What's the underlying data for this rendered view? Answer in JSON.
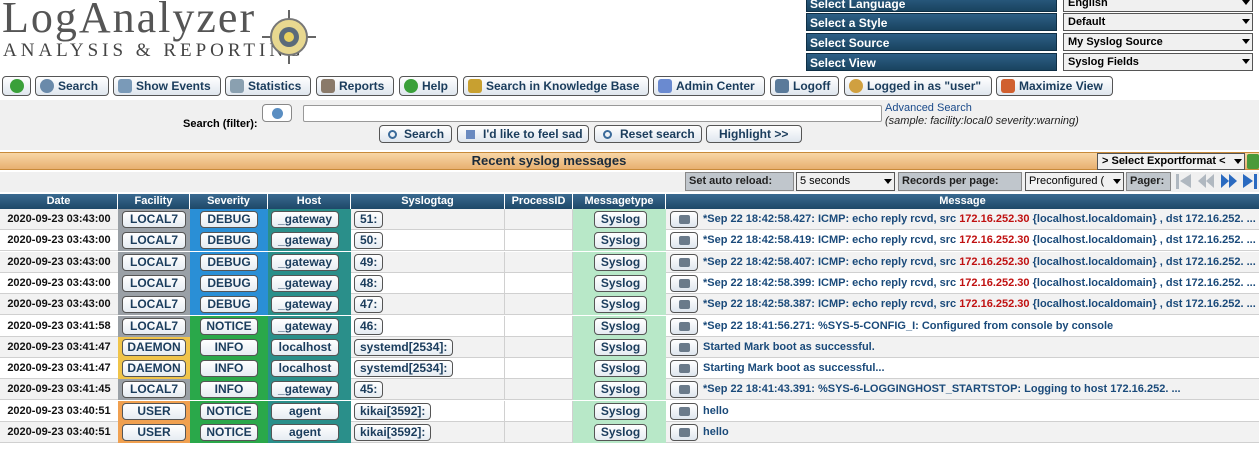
{
  "logo": {
    "title": "LogAnalyzer",
    "subtitle": "ANALYSIS & REPORTING"
  },
  "settings": [
    {
      "label": "Select Language",
      "value": "English"
    },
    {
      "label": "Select a Style",
      "value": "Default"
    },
    {
      "label": "Select Source",
      "value": "My Syslog Source"
    },
    {
      "label": "Select View",
      "value": "Syslog Fields"
    }
  ],
  "toolbar": {
    "search": "Search",
    "show_events": "Show Events",
    "statistics": "Statistics",
    "reports": "Reports",
    "help": "Help",
    "kb": "Search in Knowledge Base",
    "admin": "Admin Center",
    "logoff": "Logoff",
    "logged_in": "Logged in as \"user\"",
    "maximize": "Maximize View"
  },
  "search": {
    "label": "Search (filter):",
    "value": "",
    "advanced": "Advanced Search",
    "sample": "(sample: facility:local0 severity:warning)",
    "btn_search": "Search",
    "btn_sad": "I'd like to feel sad",
    "btn_reset": "Reset search",
    "btn_highlight": "Highlight >>"
  },
  "section": {
    "title": "Recent syslog messages",
    "export": "> Select Exportformat <"
  },
  "pager": {
    "auto_reload_label": "Set auto reload:",
    "auto_reload_value": "5 seconds",
    "records_label": "Records per page:",
    "records_value": "Preconfigured (",
    "pager_label": "Pager:"
  },
  "columns": [
    "Date",
    "Facility",
    "Severity",
    "Host",
    "Syslogtag",
    "ProcessID",
    "Messagetype",
    "Message"
  ],
  "colors": {
    "local7": "#9aa0a6",
    "daemon": "#f0c44a",
    "user": "#f0a050",
    "debug": "#2a8fd6",
    "notice": "#2aa84a",
    "info": "#2aa84a",
    "host": "#2a8f8a",
    "msgtype": "#b8e8c8",
    "ip": "#c01010"
  },
  "rows": [
    {
      "date": "2020-09-23 03:43:00",
      "facility": "LOCAL7",
      "fcolor": "local7",
      "severity": "DEBUG",
      "scolor": "debug",
      "host": "_gateway",
      "tag": "51:",
      "pid": "",
      "type": "Syslog",
      "msg_pre": "*Sep 22 18:42:58.427: ICMP: echo reply rcvd, src ",
      "msg_ip": "172.16.252.30",
      "msg_post": " {localhost.localdomain} , dst 172.16.252. ..."
    },
    {
      "date": "2020-09-23 03:43:00",
      "facility": "LOCAL7",
      "fcolor": "local7",
      "severity": "DEBUG",
      "scolor": "debug",
      "host": "_gateway",
      "tag": "50:",
      "pid": "",
      "type": "Syslog",
      "msg_pre": "*Sep 22 18:42:58.419: ICMP: echo reply rcvd, src ",
      "msg_ip": "172.16.252.30",
      "msg_post": " {localhost.localdomain} , dst 172.16.252. ..."
    },
    {
      "date": "2020-09-23 03:43:00",
      "facility": "LOCAL7",
      "fcolor": "local7",
      "severity": "DEBUG",
      "scolor": "debug",
      "host": "_gateway",
      "tag": "49:",
      "pid": "",
      "type": "Syslog",
      "msg_pre": "*Sep 22 18:42:58.407: ICMP: echo reply rcvd, src ",
      "msg_ip": "172.16.252.30",
      "msg_post": " {localhost.localdomain} , dst 172.16.252. ..."
    },
    {
      "date": "2020-09-23 03:43:00",
      "facility": "LOCAL7",
      "fcolor": "local7",
      "severity": "DEBUG",
      "scolor": "debug",
      "host": "_gateway",
      "tag": "48:",
      "pid": "",
      "type": "Syslog",
      "msg_pre": "*Sep 22 18:42:58.399: ICMP: echo reply rcvd, src ",
      "msg_ip": "172.16.252.30",
      "msg_post": " {localhost.localdomain} , dst 172.16.252. ..."
    },
    {
      "date": "2020-09-23 03:43:00",
      "facility": "LOCAL7",
      "fcolor": "local7",
      "severity": "DEBUG",
      "scolor": "debug",
      "host": "_gateway",
      "tag": "47:",
      "pid": "",
      "type": "Syslog",
      "msg_pre": "*Sep 22 18:42:58.387: ICMP: echo reply rcvd, src ",
      "msg_ip": "172.16.252.30",
      "msg_post": " {localhost.localdomain} , dst 172.16.252. ..."
    },
    {
      "date": "2020-09-23 03:41:58",
      "facility": "LOCAL7",
      "fcolor": "local7",
      "severity": "NOTICE",
      "scolor": "notice",
      "host": "_gateway",
      "tag": "46:",
      "pid": "",
      "type": "Syslog",
      "msg_pre": "*Sep 22 18:41:56.271: %SYS-5-CONFIG_I: Configured from console by console",
      "msg_ip": "",
      "msg_post": ""
    },
    {
      "date": "2020-09-23 03:41:47",
      "facility": "DAEMON",
      "fcolor": "daemon",
      "severity": "INFO",
      "scolor": "info",
      "host": "localhost",
      "tag": "systemd[2534]:",
      "pid": "",
      "type": "Syslog",
      "msg_pre": "Started Mark boot as successful.",
      "msg_ip": "",
      "msg_post": ""
    },
    {
      "date": "2020-09-23 03:41:47",
      "facility": "DAEMON",
      "fcolor": "daemon",
      "severity": "INFO",
      "scolor": "info",
      "host": "localhost",
      "tag": "systemd[2534]:",
      "pid": "",
      "type": "Syslog",
      "msg_pre": "Starting Mark boot as successful...",
      "msg_ip": "",
      "msg_post": ""
    },
    {
      "date": "2020-09-23 03:41:45",
      "facility": "LOCAL7",
      "fcolor": "local7",
      "severity": "INFO",
      "scolor": "info",
      "host": "_gateway",
      "tag": "45:",
      "pid": "",
      "type": "Syslog",
      "msg_pre": "*Sep 22 18:41:43.391: %SYS-6-LOGGINGHOST_STARTSTOP: Logging to host 172.16.252. ...",
      "msg_ip": "",
      "msg_post": ""
    },
    {
      "date": "2020-09-23 03:40:51",
      "facility": "USER",
      "fcolor": "user",
      "severity": "NOTICE",
      "scolor": "notice",
      "host": "agent",
      "tag": "kikai[3592]:",
      "pid": "",
      "type": "Syslog",
      "msg_pre": "hello",
      "msg_ip": "",
      "msg_post": ""
    },
    {
      "date": "2020-09-23 03:40:51",
      "facility": "USER",
      "fcolor": "user",
      "severity": "NOTICE",
      "scolor": "notice",
      "host": "agent",
      "tag": "kikai[3592]:",
      "pid": "",
      "type": "Syslog",
      "msg_pre": "hello",
      "msg_ip": "",
      "msg_post": ""
    }
  ]
}
